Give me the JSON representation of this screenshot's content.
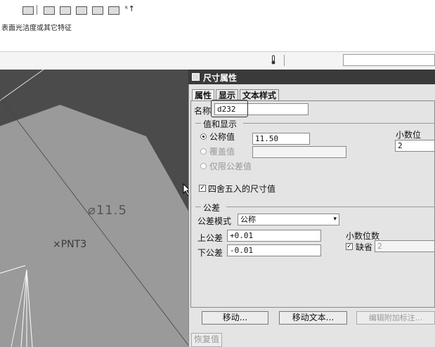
{
  "toolbar": {
    "icons": [
      "feature-icon",
      "toolbar-icon-1",
      "toolbar-icon-2",
      "toolbar-icon-3",
      "toolbar-icon-4",
      "toolbar-icon-5",
      "toolbar-icon-6"
    ]
  },
  "feature_bar": {
    "label": "表面光洁度或其它特征"
  },
  "viewport": {
    "dimension_label": "⌀11.5",
    "point_label": "×PNT3"
  },
  "dialog": {
    "title": "尺寸属性",
    "tabs": [
      {
        "label": "属性",
        "active": true
      },
      {
        "label": "显示",
        "active": false
      },
      {
        "label": "文本样式",
        "active": false
      }
    ],
    "name_label": "名称",
    "name_value": "d232",
    "value_group": {
      "title": "值和显示",
      "options": [
        {
          "label": "公称值",
          "selected": true,
          "enabled": true
        },
        {
          "label": "覆盖值",
          "selected": false,
          "enabled": false
        },
        {
          "label": "仅限公差值",
          "selected": false,
          "enabled": false
        }
      ],
      "nominal_value": "11.50",
      "override_value": "",
      "decimal_label": "小数位",
      "decimal_value": "2"
    },
    "round_checkbox": {
      "label": "四舍五入的尺寸值",
      "checked": true
    },
    "tolerance_group": {
      "title": "公差",
      "mode_label": "公差模式",
      "mode_value": "公称",
      "upper_label": "上公差",
      "upper_value": "+0.01",
      "lower_label": "下公差",
      "lower_value": "-0.01",
      "decimal_label": "小数位数",
      "default_label": "缺省",
      "default_checked": true,
      "default_value": "2"
    },
    "buttons": {
      "move": "移动...",
      "move_text": "移动文本...",
      "edit_note": "编辑附加标注..."
    },
    "restore_label": "恢复值"
  }
}
